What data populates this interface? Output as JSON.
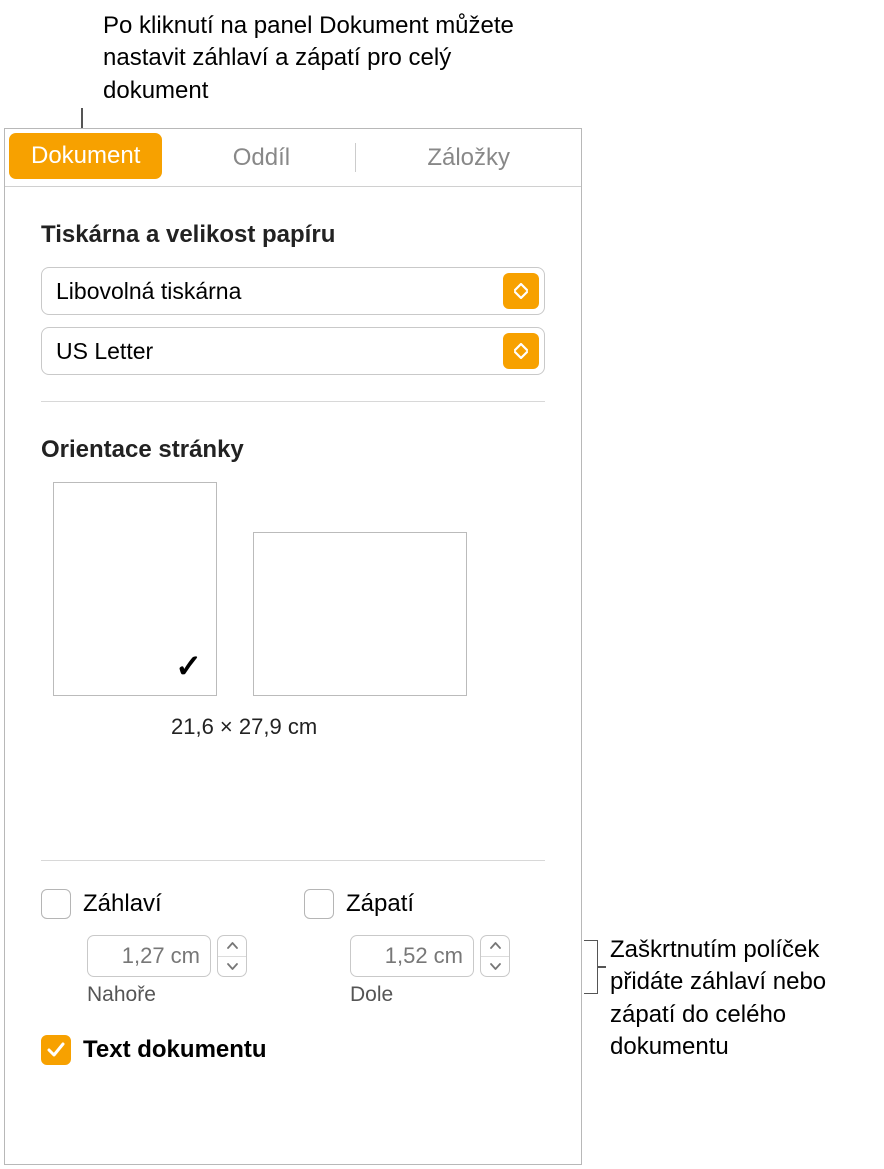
{
  "callouts": {
    "top": "Po kliknutí na panel Dokument můžete nastavit záhlaví a zápatí pro celý dokument",
    "right": "Zaškrtnutím políček přidáte záhlaví nebo zápatí do celého dokumentu"
  },
  "tabs": {
    "document": "Dokument",
    "section": "Oddíl",
    "bookmarks": "Záložky"
  },
  "printer_section": {
    "title": "Tiskárna a velikost papíru",
    "printer": "Libovolná tiskárna",
    "paper": "US Letter"
  },
  "orientation": {
    "title": "Orientace stránky",
    "size_text": "21,6 × 27,9 cm"
  },
  "header": {
    "label": "Záhlaví",
    "value": "1,27 cm",
    "position": "Nahoře"
  },
  "footer": {
    "label": "Zápatí",
    "value": "1,52 cm",
    "position": "Dole"
  },
  "body_text": "Text dokumentu"
}
